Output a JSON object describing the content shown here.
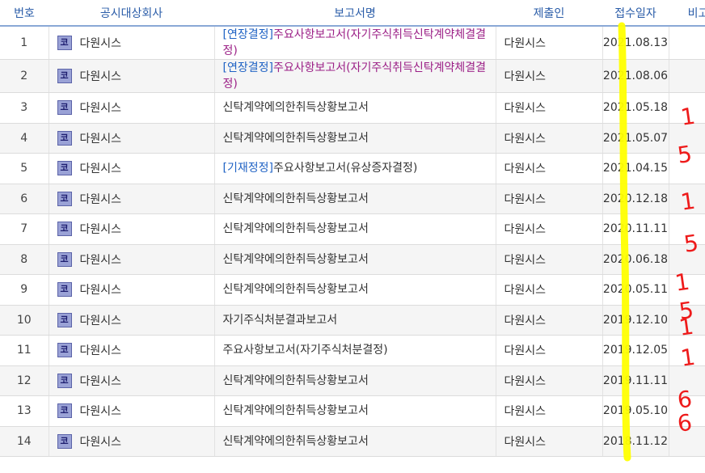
{
  "columns": [
    "번호",
    "공시대상회사",
    "보고서명",
    "제출인",
    "접수일자",
    "비고"
  ],
  "badge_char": "코",
  "rows": [
    {
      "num": "1",
      "company": "다원시스",
      "tag": "[연장결정]",
      "tag_color": "blue",
      "report": "주요사항보고서(자기주식취득신탁계약체결결정)",
      "report_color": "purple",
      "filer": "다원시스",
      "date": "2021.08.13",
      "note": ""
    },
    {
      "num": "2",
      "company": "다원시스",
      "tag": "[연장결정]",
      "tag_color": "blue",
      "report": "주요사항보고서(자기주식취득신탁계약체결결정)",
      "report_color": "purple",
      "filer": "다원시스",
      "date": "2021.08.06",
      "note": ""
    },
    {
      "num": "3",
      "company": "다원시스",
      "tag": "",
      "report": "신탁계약에의한취득상황보고서",
      "filer": "다원시스",
      "date": "2021.05.18",
      "note": ""
    },
    {
      "num": "4",
      "company": "다원시스",
      "tag": "",
      "report": "신탁계약에의한취득상황보고서",
      "filer": "다원시스",
      "date": "2021.05.07",
      "note": ""
    },
    {
      "num": "5",
      "company": "다원시스",
      "tag": "[기재정정]",
      "tag_color": "blue",
      "report": "주요사항보고서(유상증자결정)",
      "filer": "다원시스",
      "date": "2021.04.15",
      "note": ""
    },
    {
      "num": "6",
      "company": "다원시스",
      "tag": "",
      "report": "신탁계약에의한취득상황보고서",
      "filer": "다원시스",
      "date": "2020.12.18",
      "note": ""
    },
    {
      "num": "7",
      "company": "다원시스",
      "tag": "",
      "report": "신탁계약에의한취득상황보고서",
      "filer": "다원시스",
      "date": "2020.11.11",
      "note": ""
    },
    {
      "num": "8",
      "company": "다원시스",
      "tag": "",
      "report": "신탁계약에의한취득상황보고서",
      "filer": "다원시스",
      "date": "2020.06.18",
      "note": ""
    },
    {
      "num": "9",
      "company": "다원시스",
      "tag": "",
      "report": "신탁계약에의한취득상황보고서",
      "filer": "다원시스",
      "date": "2020.05.11",
      "note": ""
    },
    {
      "num": "10",
      "company": "다원시스",
      "tag": "",
      "report": "자기주식처분결과보고서",
      "filer": "다원시스",
      "date": "2019.12.10",
      "note": ""
    },
    {
      "num": "11",
      "company": "다원시스",
      "tag": "",
      "report": "주요사항보고서(자기주식처분결정)",
      "filer": "다원시스",
      "date": "2019.12.05",
      "note": ""
    },
    {
      "num": "12",
      "company": "다원시스",
      "tag": "",
      "report": "신탁계약에의한취득상황보고서",
      "filer": "다원시스",
      "date": "2019.11.11",
      "note": ""
    },
    {
      "num": "13",
      "company": "다원시스",
      "tag": "",
      "report": "신탁계약에의한취득상황보고서",
      "filer": "다원시스",
      "date": "2019.05.10",
      "note": ""
    },
    {
      "num": "14",
      "company": "다원시스",
      "tag": "",
      "report": "신탁계약에의한취득상황보고서",
      "filer": "다원시스",
      "date": "2018.11.12",
      "note": ""
    }
  ],
  "annotations": {
    "highlight_color": "#ffff00",
    "ink_color": "#ee1b1b",
    "marks": [
      "1",
      "5",
      "1",
      "5",
      "1",
      "5",
      "1",
      "1",
      "6",
      "6"
    ]
  }
}
